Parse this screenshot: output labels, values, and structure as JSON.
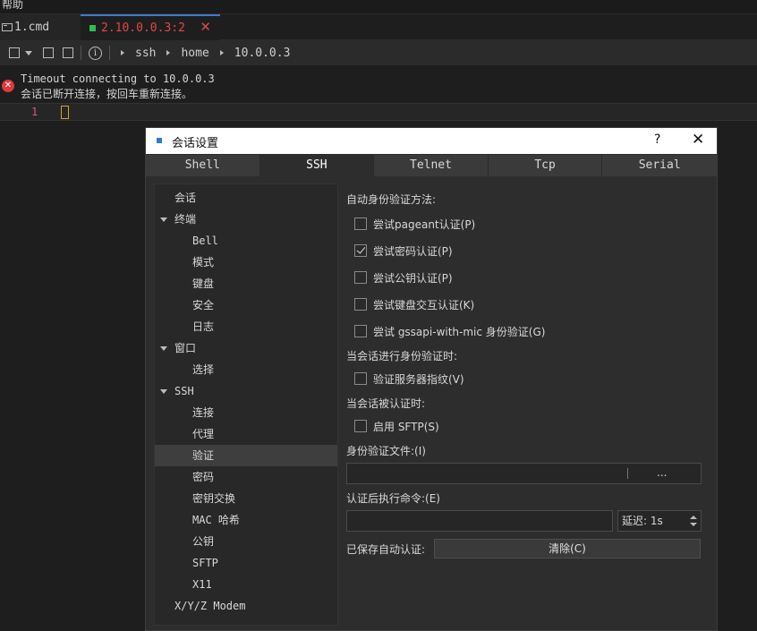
{
  "menubar": {
    "label": "帮助"
  },
  "tabs": [
    {
      "label": "1.cmd"
    },
    {
      "label": "2.10.0.0.3:2",
      "close": "✕"
    }
  ],
  "breadcrumb": [
    "ssh",
    "home",
    "10.0.0.3"
  ],
  "terminal": {
    "error_title": "Timeout connecting to 10.0.0.3",
    "error_detail": "会话已断开连接，按回车重新连接。",
    "line_number": "1"
  },
  "dialog": {
    "title": "会话设置",
    "help": "?",
    "close": "✕",
    "tabs": [
      "Shell",
      "SSH",
      "Telnet",
      "Tcp",
      "Serial"
    ],
    "tree": [
      {
        "label": "会话",
        "level": 0,
        "expand": false
      },
      {
        "label": "终端",
        "level": 0,
        "expand": true
      },
      {
        "label": "Bell",
        "level": 1
      },
      {
        "label": "模式",
        "level": 1
      },
      {
        "label": "键盘",
        "level": 1
      },
      {
        "label": "安全",
        "level": 1
      },
      {
        "label": "日志",
        "level": 1
      },
      {
        "label": "窗口",
        "level": 0,
        "expand": true
      },
      {
        "label": "选择",
        "level": 1
      },
      {
        "label": "SSH",
        "level": 0,
        "expand": true
      },
      {
        "label": "连接",
        "level": 1
      },
      {
        "label": "代理",
        "level": 1
      },
      {
        "label": "验证",
        "level": 1,
        "selected": true
      },
      {
        "label": "密码",
        "level": 1
      },
      {
        "label": "密钥交换",
        "level": 1
      },
      {
        "label": "MAC 哈希",
        "level": 1
      },
      {
        "label": "公钥",
        "level": 1
      },
      {
        "label": "SFTP",
        "level": 1
      },
      {
        "label": "X11",
        "level": 1
      },
      {
        "label": "X/Y/Z Modem",
        "level": 0,
        "expand": false
      }
    ],
    "auth": {
      "methods_label": "自动身份验证方法:",
      "methods": [
        {
          "label": "尝试pageant认证(P)",
          "checked": false
        },
        {
          "label": "尝试密码认证(P)",
          "checked": true
        },
        {
          "label": "尝试公钥认证(P)",
          "checked": false
        },
        {
          "label": "尝试键盘交互认证(K)",
          "checked": false
        },
        {
          "label": "尝试 gssapi-with-mic 身份验证(G)",
          "checked": false
        }
      ],
      "during_label": "当会话进行身份验证时:",
      "verify_fp": {
        "label": "验证服务器指纹(V)",
        "checked": false
      },
      "after_label": "当会话被认证时:",
      "sftp": {
        "label": "启用 SFTP(S)",
        "checked": false
      },
      "keyfile_label": "身份验证文件:(I)",
      "keyfile_value": "",
      "browse": "...",
      "post_cmd_label": "认证后执行命令:(E)",
      "post_cmd_value": "",
      "delay": "延迟: 1s",
      "saved_label": "已保存自动认证:",
      "clear_button": "清除(C)"
    }
  }
}
